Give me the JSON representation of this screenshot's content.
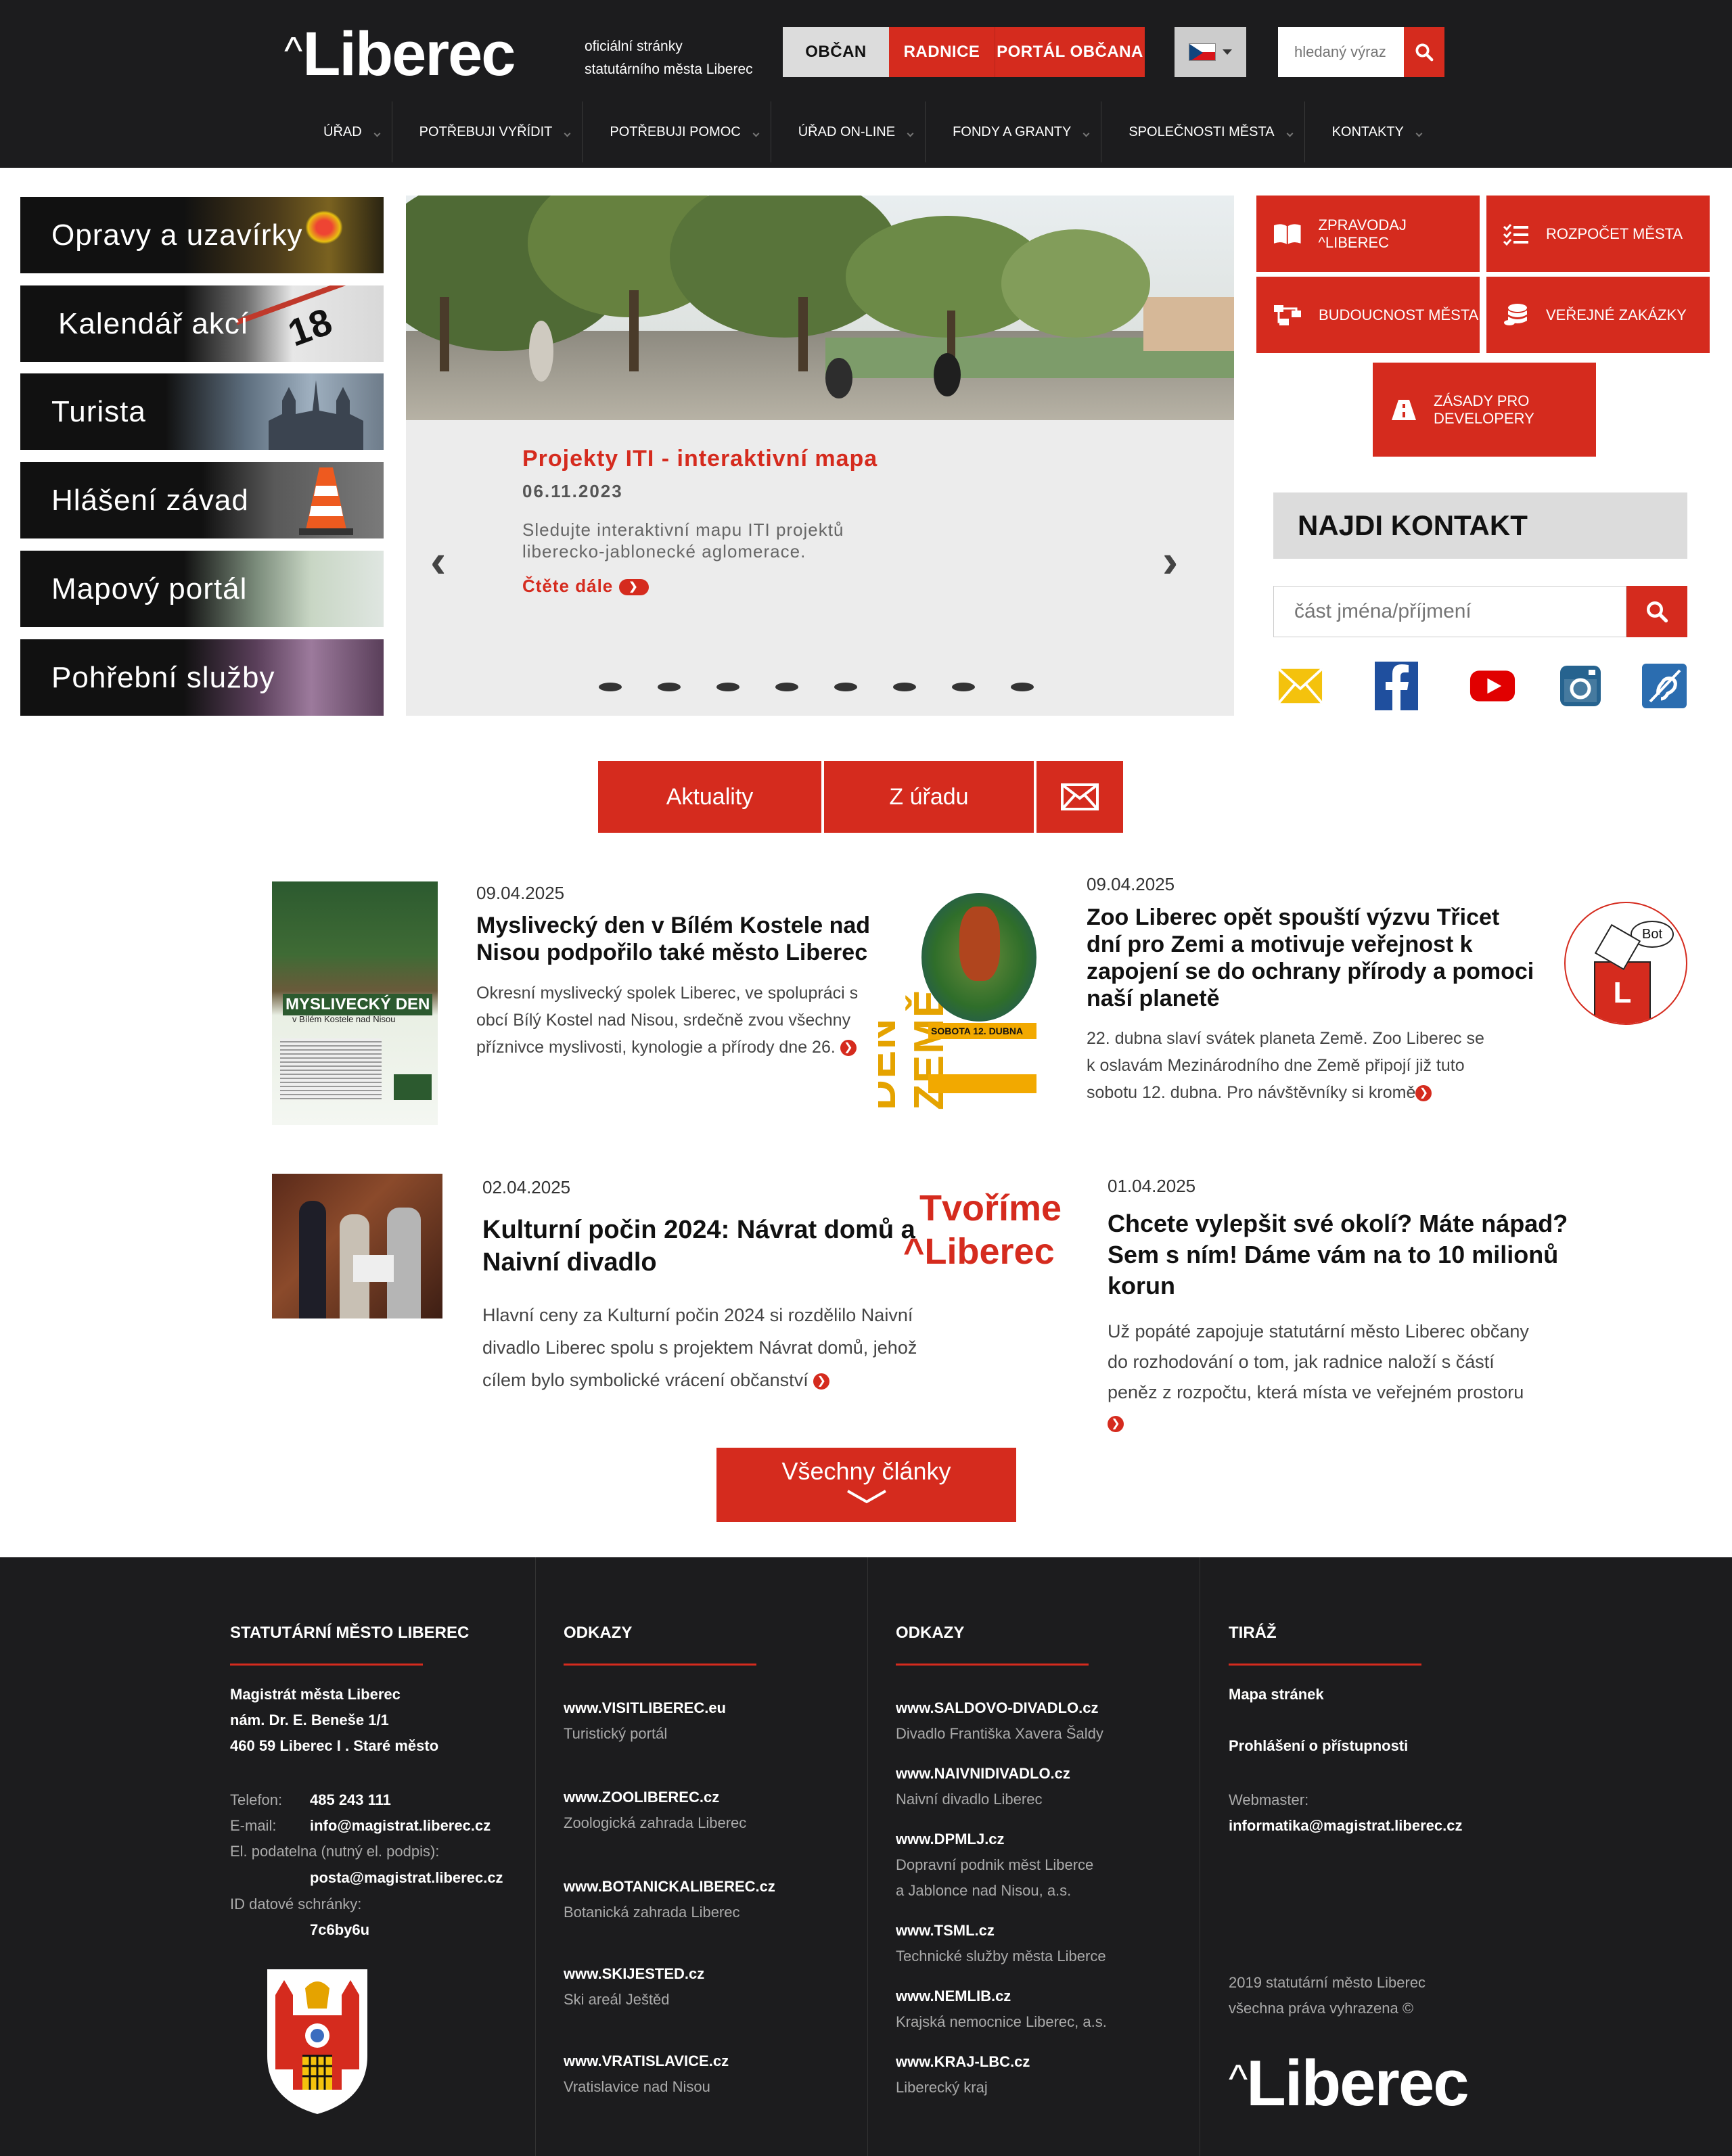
{
  "header": {
    "logo": "Liberec",
    "tagline_1": "oficiální stránky",
    "tagline_2": "statutárního města Liberec",
    "tab_obcan": "OBČAN",
    "tab_radnice": "RADNICE",
    "tab_portal": "PORTÁL OBČANA",
    "search_placeholder": "hledaný výraz",
    "nav": [
      "ÚŘAD",
      "POTŘEBUJI VYŘÍDIT",
      "POTŘEBUJI POMOC",
      "ÚŘAD ON-LINE",
      "FONDY A GRANTY",
      "SPOLEČNOSTI MĚSTA",
      "KONTAKTY"
    ]
  },
  "quick_tiles": [
    "Opravy a uzavírky",
    "Kalendář akcí",
    "Turista",
    "Hlášení závad",
    "Mapový portál",
    "Pohřební služby"
  ],
  "slider": {
    "title": "Projekty ITI - interaktivní mapa",
    "date": "06.11.2023",
    "text_1": "Sledujte interaktivní mapu ITI projektů",
    "text_2": "liberecko-jablonecké aglomerace.",
    "more": "Čtěte dále",
    "dots": 8
  },
  "pills": {
    "zpravodaj": "ZPRAVODAJ ^LIBEREC",
    "rozpocet": "ROZPOČET MĚSTA",
    "budoucnost": "BUDOUCNOST MĚSTA",
    "zakazky": "VEŘEJNÉ ZAKÁZKY",
    "zasady_1": "ZÁSADY PRO",
    "zasady_2": "DEVELOPERY"
  },
  "contact": {
    "heading": "NAJDI KONTAKT",
    "placeholder": "část jména/příjmení"
  },
  "news_tabs": {
    "aktuality": "Aktuality",
    "z_uradu": "Z úřadu"
  },
  "articles": [
    {
      "date": "09.04.2025",
      "title_1": "Myslivecký den v Bílém Kostele nad",
      "title_2": "Nisou podpořilo také město Liberec",
      "text_1": "Okresní myslivecký spolek Liberec, ve spolupráci s",
      "text_2": "obcí Bílý Kostel nad Nisou, srdečně zvou všechny",
      "text_3": "příznivce myslivosti, kynologie a přírody dne 26.",
      "img_title": "MYSLIVECKÝ DEN",
      "img_sub": "v Bílém Kostele nad Nisou"
    },
    {
      "date": "09.04.2025",
      "title_1": "Zoo Liberec opět spouští výzvu Třicet",
      "title_2": "dní pro Zemi a motivuje veřejnost k",
      "title_3": "zapojení se do ochrany přírody a pomoci",
      "title_4": "naší planetě",
      "text_1": "22. dubna slaví svátek planeta Země. Zoo Liberec se",
      "text_2": "k oslavám Mezinárodního dne Země připojí již tuto",
      "text_3": "sobotu 12. dubna. Pro návštěvníky si kromě",
      "img_word": "DEN ZEMĚ",
      "img_date": "SOBOTA 12. DUBNA"
    },
    {
      "date": "02.04.2025",
      "title_1": "Kulturní počin 2024: Návrat domů a",
      "title_2": "Naivní divadlo",
      "text_1": "Hlavní ceny za Kulturní počin 2024 si rozdělilo Naivní",
      "text_2": "divadlo Liberec spolu s projektem Návrat domů, jehož",
      "text_3": "cílem bylo symbolické vrácení občanství"
    },
    {
      "date": "01.04.2025",
      "title_1": "Chcete vylepšit své okolí? Máte nápad?",
      "title_2": "Sem s ním! Dáme vám na to 10 milionů",
      "title_3": "korun",
      "text_1": "Už popáté zapojuje statutární město Liberec občany",
      "text_2": "do rozhodování o tom, jak radnice naloží s částí",
      "text_3": "peněz z rozpočtu, která místa ve veřejném prostoru",
      "logo_1": "Tvoříme",
      "logo_2": "^Liberec"
    }
  ],
  "all_articles": "Všechny články",
  "bot": "Bot",
  "footer": {
    "col1": {
      "heading": "STATUTÁRNÍ MĚSTO LIBEREC",
      "addr_1": "Magistrát města Liberec",
      "addr_2": "nám. Dr. E. Beneše 1/1",
      "addr_3": "460 59 Liberec I . Staré město",
      "tel_label": "Telefon:",
      "tel": "485 243 111",
      "email_label": "E-mail:",
      "email": "info@magistrat.liberec.cz",
      "podatelna_label": "El. podatelna (nutný el. podpis):",
      "podatelna": "posta@magistrat.liberec.cz",
      "ds_label": "ID datové schránky:",
      "ds": "7c6by6u"
    },
    "col2": {
      "heading": "ODKAZY",
      "links": [
        {
          "url": "www.VISITLIBEREC.eu",
          "desc": "Turistický portál"
        },
        {
          "url": "www.ZOOLIBEREC.cz",
          "desc": "Zoologická zahrada Liberec"
        },
        {
          "url": "www.BOTANICKALIBEREC.cz",
          "desc": "Botanická zahrada Liberec"
        },
        {
          "url": "www.SKIJESTED.cz",
          "desc": "Ski areál Ještěd"
        },
        {
          "url": "www.VRATISLAVICE.cz",
          "desc": "Vratislavice nad Nisou"
        }
      ]
    },
    "col3": {
      "heading": "ODKAZY",
      "links": [
        {
          "url": "www.SALDOVO-DIVADLO.cz",
          "desc": "Divadlo Františka Xavera Šaldy"
        },
        {
          "url": "www.NAIVNIDIVADLO.cz",
          "desc": "Naivní divadlo Liberec"
        },
        {
          "url": "www.DPMLJ.cz",
          "desc": "Dopravní podnik měst Liberce",
          "desc2": "a Jablonce nad Nisou, a.s."
        },
        {
          "url": "www.TSML.cz",
          "desc": "Technické služby města Liberce"
        },
        {
          "url": "www.NEMLIB.cz",
          "desc": "Krajská nemocnice Liberec, a.s."
        },
        {
          "url": "www.KRAJ-LBC.cz",
          "desc": "Liberecký kraj"
        }
      ]
    },
    "col4": {
      "heading": "TIRÁŽ",
      "mapa": "Mapa stránek",
      "prohlaseni": "Prohlášení o přístupnosti",
      "webmaster_label": "Webmaster:",
      "webmaster": "informatika@magistrat.liberec.cz",
      "copy_1": "2019 statutární město Liberec",
      "copy_2": "všechna práva vyhrazena ©",
      "logo": "Liberec"
    }
  },
  "colors": {
    "accent": "#d52b1e",
    "dark": "#1c1c1e",
    "grey": "#dcdcdc"
  }
}
